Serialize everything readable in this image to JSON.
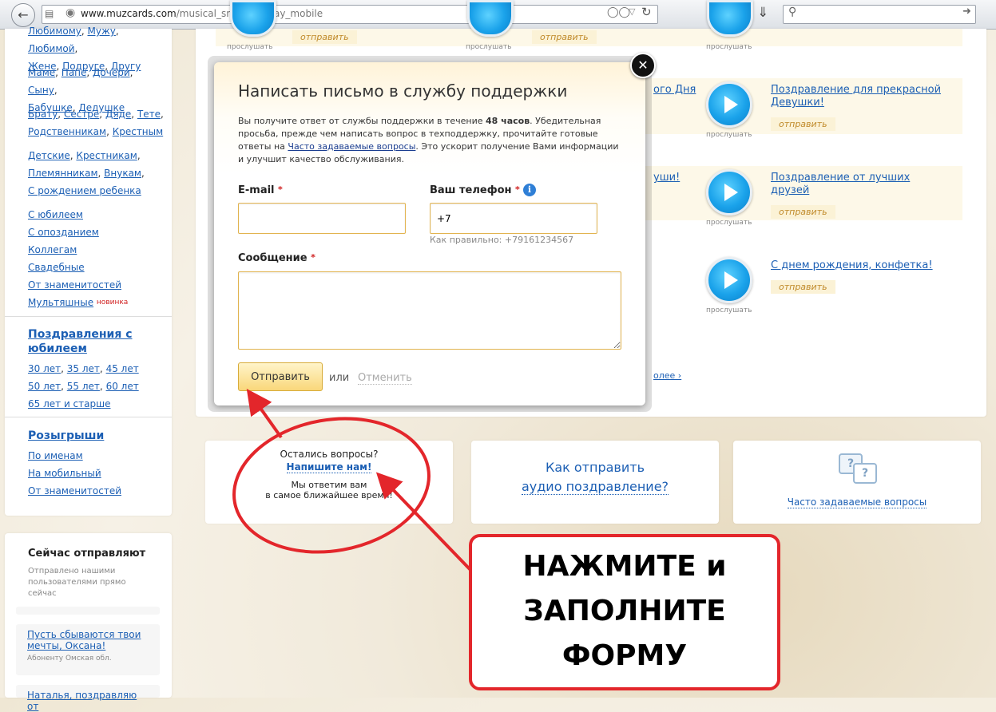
{
  "browser": {
    "url_domain": "www.muzcards.com",
    "url_path": "/musical_sms_birthday_mobile"
  },
  "sidebar": {
    "group1_partial": [
      "Любимому",
      "Мужу",
      "Любимой"
    ],
    "group1": [
      [
        "Жене",
        "Подруге",
        "Другу"
      ]
    ],
    "group2": [
      [
        "Маме",
        "Папе",
        "Дочери",
        "Сыну"
      ],
      [
        "Бабушке",
        "Дедушке"
      ]
    ],
    "group3": [
      [
        "Брату",
        "Сестре",
        "Дяде",
        "Тете"
      ],
      [
        "Родственникам",
        "Крестным"
      ]
    ],
    "group4": [
      [
        "Детские",
        "Крестникам"
      ],
      [
        "Племянникам",
        "Внукам"
      ],
      [
        "С рождением ребенка"
      ]
    ],
    "group5": [
      "С юбилеем",
      "С опозданием",
      "Коллегам",
      "Свадебные",
      "От знаменитостей",
      "Мультяшные"
    ],
    "new_badge": "новинка",
    "jubilee_head": "Поздравления с юбилеем",
    "jubilee_links": [
      [
        "30 лет",
        "35 лет",
        "45 лет"
      ],
      [
        "50 лет",
        "55 лет",
        "60 лет"
      ],
      [
        "65 лет и старше"
      ]
    ],
    "draws_head": "Розыгрыши",
    "draws_links": [
      "По именам",
      "На мобильный",
      "От знаменитостей"
    ]
  },
  "now_sending": {
    "title": "Сейчас отправляют",
    "desc": "Отправлено нашими пользователями прямо сейчас",
    "items": [
      {
        "link": "Пусть сбываются твои мечты, Оксана!",
        "sub": "Абоненту Омская обл."
      },
      {
        "link": "Наталья, поздравляю от",
        "sub": ""
      }
    ]
  },
  "main": {
    "listen_label": "прослушать",
    "send_label": "отправить",
    "partial_left_links": [
      "ого Дня",
      "уши!"
    ],
    "greetings": [
      {
        "title": "Поздравление для прекрасной Девушки!"
      },
      {
        "title": "Поздравление от лучших друзей"
      },
      {
        "title": "С днем рождения, конфетка!"
      }
    ],
    "more_link": "олее ›"
  },
  "info_boxes": {
    "questions": {
      "line1": "Остались вопросы?",
      "link": "Напишите нам!",
      "line2": "Мы ответим вам",
      "line3": "в самое ближайшее время!"
    },
    "how_to": {
      "line1": "Как отправить",
      "line2": "аудио поздравление?"
    },
    "faq": {
      "link": "Часто задаваемые вопросы"
    }
  },
  "modal": {
    "title": "Написать письмо в службу поддержки",
    "desc_part1": "Вы получите ответ от службы поддержки в течение ",
    "desc_bold": "48 часов",
    "desc_part2": ". Убедительная просьба, прежде чем написать вопрос в техподдержку, прочитайте готовые ответы на ",
    "desc_link": "Часто задаваемые вопросы",
    "desc_part3": ". Это ускорит получение Вами информации и улучшит качество обслуживания.",
    "email_label": "E-mail",
    "phone_label": "Ваш телефон",
    "phone_value": "+7",
    "phone_hint": "Как правильно: +79161234567",
    "message_label": "Сообщение",
    "required_mark": "*",
    "submit_label": "Отправить",
    "or_text": "или",
    "cancel_label": "Отменить"
  },
  "annotation": {
    "lines": [
      "НАЖМИТЕ и",
      "ЗАПОЛНИТЕ",
      "ФОРМУ"
    ],
    "color": "#e3262b"
  }
}
